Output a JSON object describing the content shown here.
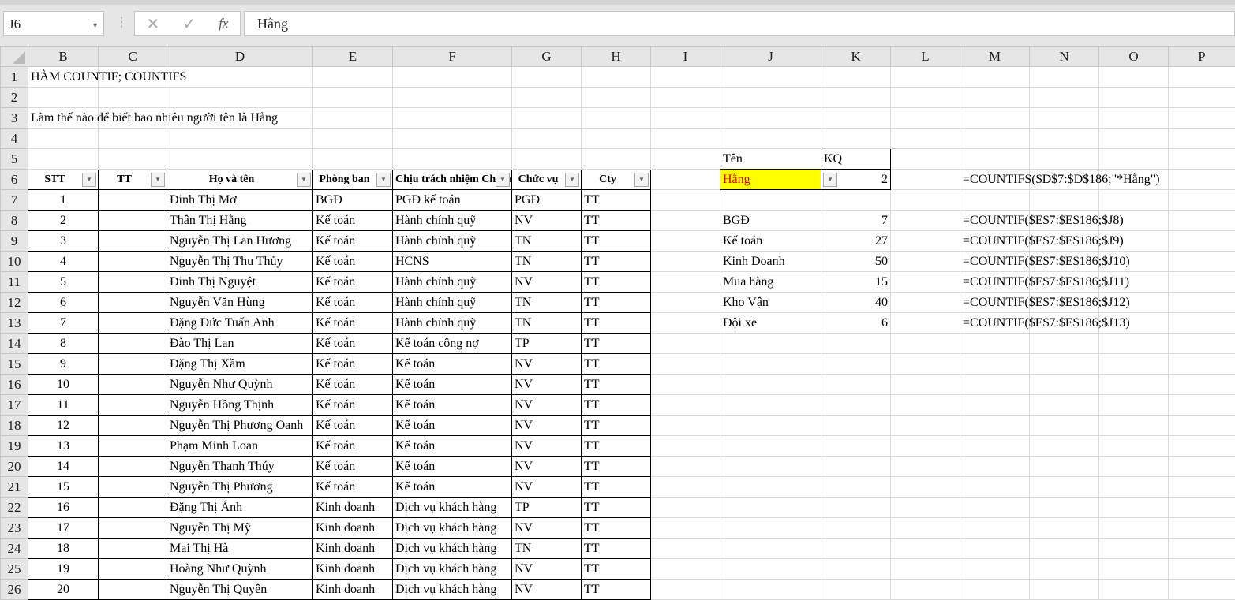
{
  "name_box": "J6",
  "formula_bar": "Hằng",
  "columns": [
    "B",
    "C",
    "D",
    "E",
    "F",
    "G",
    "H",
    "I",
    "J",
    "K",
    "L",
    "M",
    "N",
    "O",
    "P"
  ],
  "title": "HÀM COUNTIF; COUNTIFS",
  "question": "Làm thế nào để biết bao nhiêu người tên là Hằng",
  "table_headers": [
    "STT",
    "TT",
    "Họ và tên",
    "Phòng ban",
    "Chịu trách nhiệm Chính",
    "Chức vụ",
    "Cty"
  ],
  "table_rows": [
    [
      "1",
      "",
      "Đinh Thị Mơ",
      "BGĐ",
      "PGĐ kế toán",
      "PGĐ",
      "TT"
    ],
    [
      "2",
      "",
      "Thân Thị Hằng",
      "Kế toán",
      "Hành chính quỹ",
      "NV",
      "TT"
    ],
    [
      "3",
      "",
      "Nguyễn Thị Lan Hương",
      "Kế toán",
      "Hành chính quỹ",
      "TN",
      "TT"
    ],
    [
      "4",
      "",
      "Nguyễn Thị Thu Thủy",
      "Kế toán",
      "HCNS",
      "TN",
      "TT"
    ],
    [
      "5",
      "",
      "Đinh Thị Nguyệt",
      "Kế toán",
      "Hành chính quỹ",
      "NV",
      "TT"
    ],
    [
      "6",
      "",
      "Nguyễn Văn Hùng",
      "Kế toán",
      "Hành chính quỹ",
      "TN",
      "TT"
    ],
    [
      "7",
      "",
      "Đặng Đức Tuấn Anh",
      "Kế toán",
      "Hành chính quỹ",
      "TN",
      "TT"
    ],
    [
      "8",
      "",
      "Đào Thị Lan",
      "Kế toán",
      "Kế toán công nợ",
      "TP",
      "TT"
    ],
    [
      "9",
      "",
      "Đặng Thị Xầm",
      "Kế toán",
      "Kế toán",
      "NV",
      "TT"
    ],
    [
      "10",
      "",
      "Nguyễn Như Quỳnh",
      "Kế toán",
      "Kế toán",
      "NV",
      "TT"
    ],
    [
      "11",
      "",
      "Nguyễn Hồng Thịnh",
      "Kế toán",
      "Kế toán",
      "NV",
      "TT"
    ],
    [
      "12",
      "",
      "Nguyễn Thị Phương Oanh",
      "Kế toán",
      "Kế toán",
      "NV",
      "TT"
    ],
    [
      "13",
      "",
      "Phạm Minh Loan",
      "Kế toán",
      "Kế toán",
      "NV",
      "TT"
    ],
    [
      "14",
      "",
      "Nguyễn Thanh Thúy",
      "Kế toán",
      "Kế toán",
      "NV",
      "TT"
    ],
    [
      "15",
      "",
      "Nguyễn Thị Phương",
      "Kế toán",
      "Kế toán",
      "NV",
      "TT"
    ],
    [
      "16",
      "",
      "Đặng Thị Ánh",
      "Kinh doanh",
      "Dịch vụ khách hàng",
      "TP",
      "TT"
    ],
    [
      "17",
      "",
      "Nguyễn Thị Mỹ",
      "Kinh doanh",
      "Dịch vụ khách hàng",
      "NV",
      "TT"
    ],
    [
      "18",
      "",
      "Mai Thị Hà",
      "Kinh doanh",
      "Dịch vụ khách hàng",
      "TN",
      "TT"
    ],
    [
      "19",
      "",
      "Hoàng Như Quỳnh",
      "Kinh doanh",
      "Dịch vụ khách hàng",
      "NV",
      "TT"
    ],
    [
      "20",
      "",
      "Nguyễn Thị Quyên",
      "Kinh doanh",
      "Dịch vụ khách hàng",
      "NV",
      "TT"
    ]
  ],
  "lookup": {
    "label_header": "Tên",
    "result_header": "KQ",
    "name": "Hằng",
    "count": "2",
    "formula": "=COUNTIFS($D$7:$D$186;\"*Hằng\")"
  },
  "summary": [
    {
      "dept": "BGĐ",
      "count": "7",
      "formula": "=COUNTIF($E$7:$E$186;$J8)"
    },
    {
      "dept": "Kế toán",
      "count": "27",
      "formula": "=COUNTIF($E$7:$E$186;$J9)"
    },
    {
      "dept": "Kinh Doanh",
      "count": "50",
      "formula": "=COUNTIF($E$7:$E$186;$J10)"
    },
    {
      "dept": "Mua hàng",
      "count": "15",
      "formula": "=COUNTIF($E$7:$E$186;$J11)"
    },
    {
      "dept": "Kho Vận",
      "count": "40",
      "formula": "=COUNTIF($E$7:$E$186;$J12)"
    },
    {
      "dept": "Đội xe",
      "count": "6",
      "formula": "=COUNTIF($E$7:$E$186;$J13)"
    }
  ],
  "colors": {
    "highlight": "#ffff00",
    "highlight_text": "#e00000"
  }
}
